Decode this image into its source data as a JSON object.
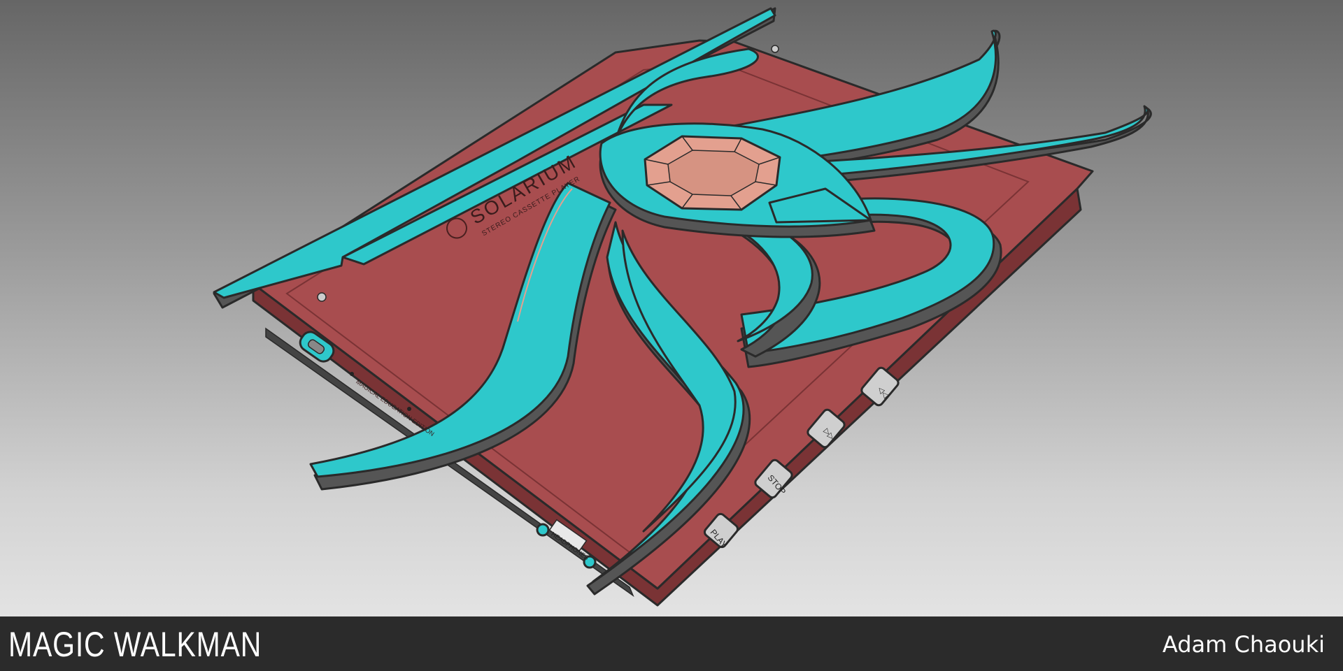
{
  "footer": {
    "title": "MAGIC WALKMAN",
    "author": "Adam Chaouki"
  },
  "device": {
    "brand": "SOLARIUM",
    "subtitle": "STEREO CASSETTE PLAYER",
    "edition_text": "MAGICAL EDUCATION EDITION",
    "headphones_label": "HEADPHONES",
    "buttons": [
      "PLAY",
      "STOP",
      "▷▷",
      "◁◁"
    ]
  },
  "colors": {
    "body": "#a84d4f",
    "body_dark": "#8a3b3d",
    "petal": "#2ec8cb",
    "shadow": "#555555",
    "gem": "#e3a08f",
    "footer": "#2b2b2b"
  }
}
